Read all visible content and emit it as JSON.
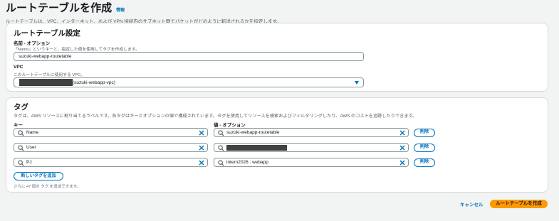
{
  "page": {
    "title": "ルートテーブルを作成",
    "info_link": "情報",
    "description": "ルートテーブルは、VPC、インターネット、および VPN 接続内のサブネット間でパケットがどのように転送されるかを指定します。"
  },
  "settings": {
    "title": "ルートテーブル設定",
    "name_label": "名前 - オプション",
    "name_hint": "「Name」というキーと、指定した値を使用してタグを作成します。",
    "name_value": "suzuki-webapp-routetable",
    "vpc_label": "VPC",
    "vpc_hint": "このルートテーブルに使用する VPC。",
    "vpc_value_suffix": "(suzuki-webapp-vpc)"
  },
  "tags": {
    "title": "タグ",
    "description": "タグは、AWS リソースに割り当てるラベルです。各タグはキーとオプションの値で構成されています。タグを使用してリソースを検索およびフィルタリングしたり、AWS のコストを追跡したりできます。",
    "key_header": "キー",
    "value_header": "値 - オプション",
    "rows": [
      {
        "key": "Name",
        "value": "suzuki-webapp-routetable",
        "remove": "削除"
      },
      {
        "key": "User",
        "value": "",
        "remove": "削除"
      },
      {
        "key": "PJ",
        "value": "intern2026 : webapp",
        "remove": "削除"
      }
    ],
    "add_button": "新しいタグを追加",
    "add_hint": "さらに 47 個の タグ を追加できます。"
  },
  "footer": {
    "cancel": "キャンセル",
    "create": "ルートテーブルを作成"
  },
  "icons": {
    "search": "search-icon",
    "clear": "close-icon",
    "caret": "caret-down-icon"
  },
  "colors": {
    "link": "#0073bb",
    "primary": "#ff9900",
    "background": "#f2f3f3"
  }
}
